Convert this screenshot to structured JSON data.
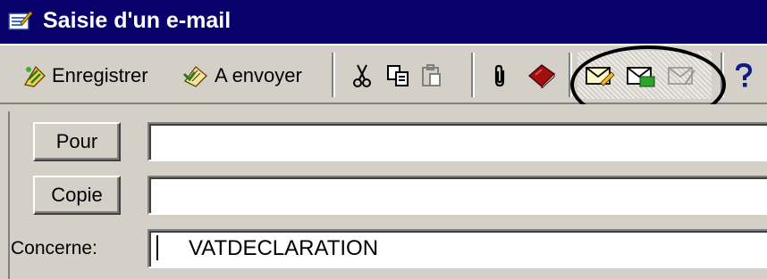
{
  "window": {
    "title": "Saisie d'un e-mail",
    "title_icon": "compose-mail-icon"
  },
  "toolbar": {
    "save_label": "Enregistrer",
    "save_icon": "save-icon",
    "to_send_label": "A envoyer",
    "to_send_icon": "outbox-icon",
    "cut_icon": "scissors-icon",
    "copy_icon": "copy-icon",
    "paste_icon": "paste-icon",
    "attach_icon": "paperclip-icon",
    "address_book_icon": "address-book-icon",
    "send_icons": [
      "send-mail-icon",
      "send-mail-confirm-icon",
      "send-mail-disabled-icon"
    ],
    "help_icon": "help-icon"
  },
  "form": {
    "to_button": "Pour",
    "to_value": "",
    "cc_button": "Copie",
    "cc_value": "",
    "subject_label": "Concerne:",
    "subject_value": "VATDECLARATION"
  },
  "colors": {
    "titlebar": "#08006b",
    "chrome": "#d4d0c8",
    "highlight_circle": "#000000"
  }
}
